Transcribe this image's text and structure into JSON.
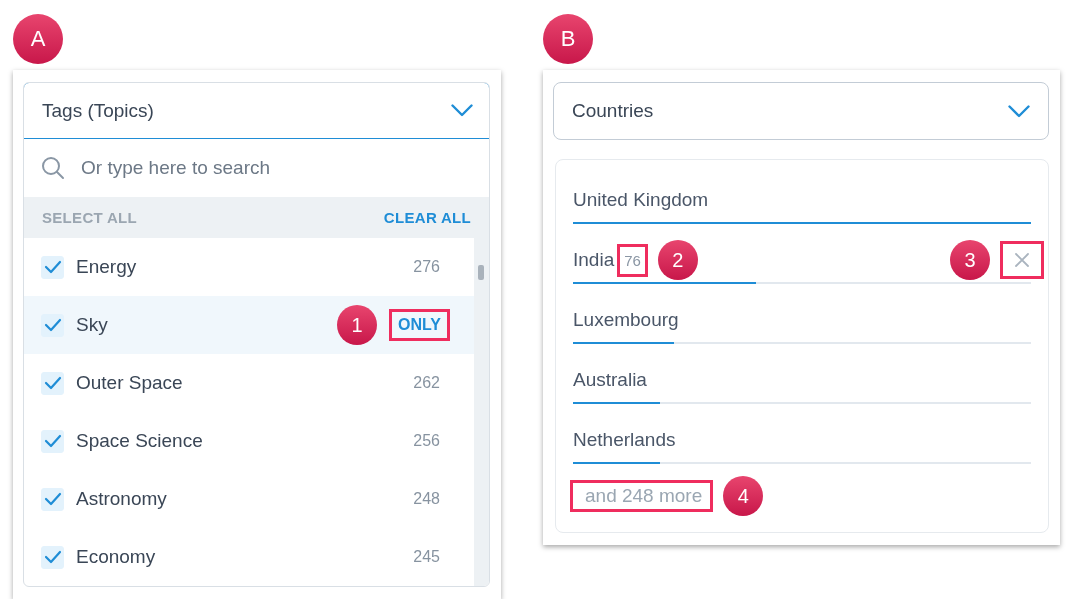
{
  "tags_panel": {
    "badge": "A",
    "dropdown": "Tags (Topics)",
    "search": {
      "placeholder": "Or type here to search"
    },
    "select_all": "SELECT ALL",
    "clear_all": "CLEAR ALL",
    "items": [
      {
        "name": "Energy",
        "count": "276",
        "checked": true,
        "hovered": false
      },
      {
        "name": "Sky",
        "only": "ONLY",
        "checked": true,
        "hovered": true,
        "callout": "1",
        "highlighted": true
      },
      {
        "name": "Outer Space",
        "count": "262",
        "checked": true,
        "hovered": false
      },
      {
        "name": "Space Science",
        "count": "256",
        "checked": true,
        "hovered": false
      },
      {
        "name": "Astronomy",
        "count": "248",
        "checked": true,
        "hovered": false
      },
      {
        "name": "Economy",
        "count": "245",
        "checked": true,
        "hovered": false
      }
    ]
  },
  "countries_panel": {
    "badge": "B",
    "dropdown": "Countries",
    "items": [
      {
        "name": "United Kingdom",
        "level": 1.0
      },
      {
        "name": "India",
        "count": "76",
        "level": 0.4,
        "count_callout": "2",
        "count_highlighted": true,
        "removable": true,
        "remove_callout": "3",
        "remove_highlighted": true
      },
      {
        "name": "Luxembourg",
        "level": 0.22
      },
      {
        "name": "Australia",
        "level": 0.19
      },
      {
        "name": "Netherlands",
        "level": 0.19
      }
    ],
    "more": {
      "text": "and 248 more",
      "callout": "4",
      "highlighted": true
    }
  }
}
